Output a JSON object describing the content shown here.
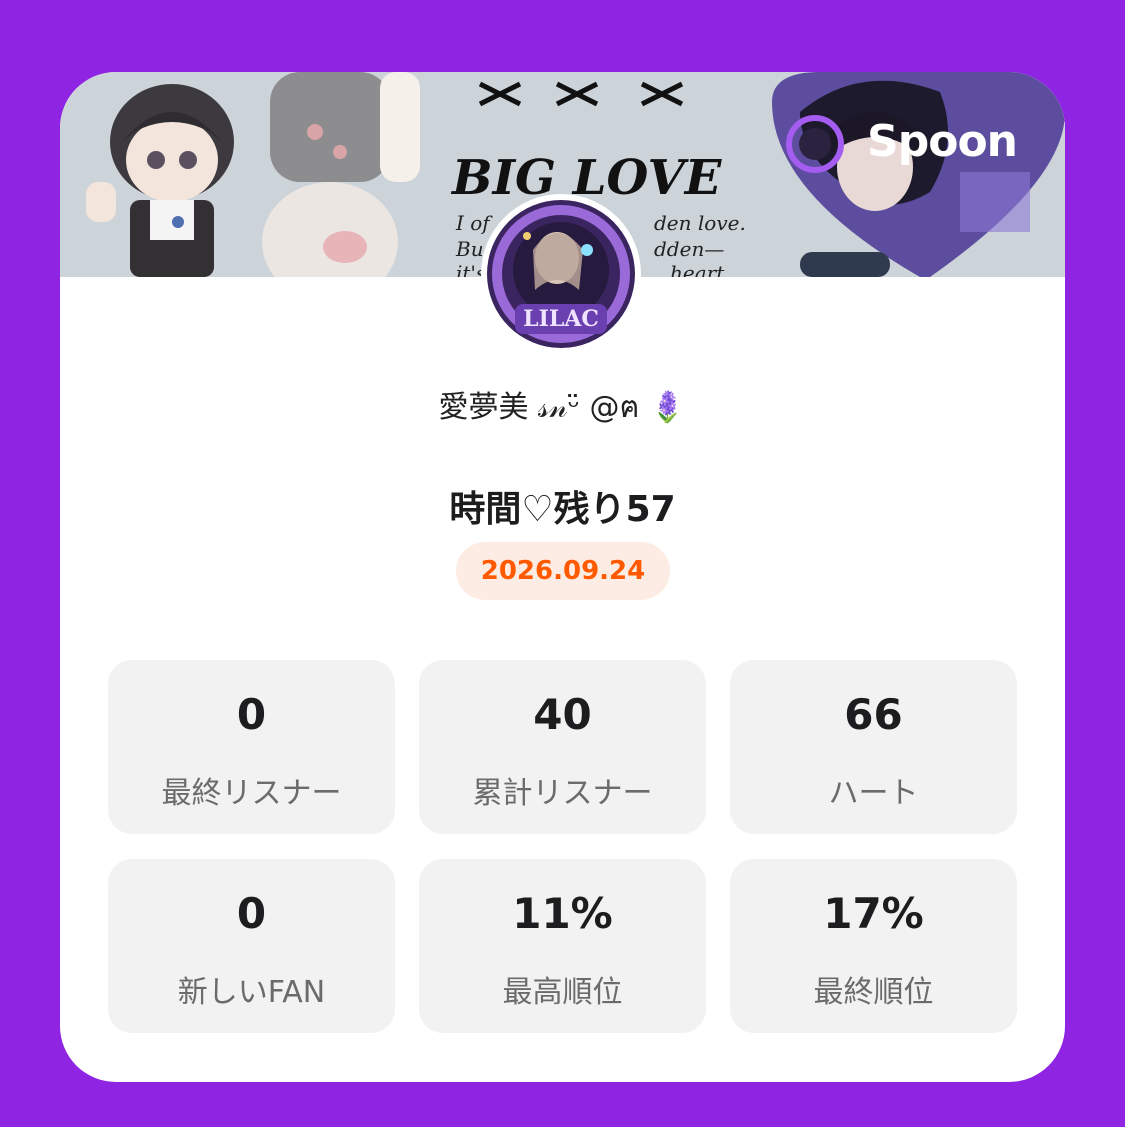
{
  "banner": {
    "brand": "Spoon",
    "headline": "BIG LOVE",
    "subtext_line1": "I of",
    "subtext_line2": "den love.",
    "subtext_line3": "Bu",
    "subtext_line4": "dden—",
    "subtext_line5": "it's",
    "subtext_line6": "heart",
    "avatar_text": "LILAC"
  },
  "profile": {
    "name": "愛夢美 𝓈𝓃ᵕ̈ @ฅ 🪻"
  },
  "live": {
    "title": "時間♡残り57",
    "date": "2026.09.24"
  },
  "stats": [
    {
      "value": "0",
      "label": "最終リスナー"
    },
    {
      "value": "40",
      "label": "累計リスナー"
    },
    {
      "value": "66",
      "label": "ハート"
    },
    {
      "value": "0",
      "label": "新しいFAN"
    },
    {
      "value": "11%",
      "label": "最高順位"
    },
    {
      "value": "17%",
      "label": "最終順位"
    }
  ],
  "colors": {
    "page_bg": "#8f25e3",
    "card_bg": "#ffffff",
    "date_text": "#ff5a00",
    "date_bg": "#fdece3",
    "stat_bg": "#f2f2f2"
  }
}
